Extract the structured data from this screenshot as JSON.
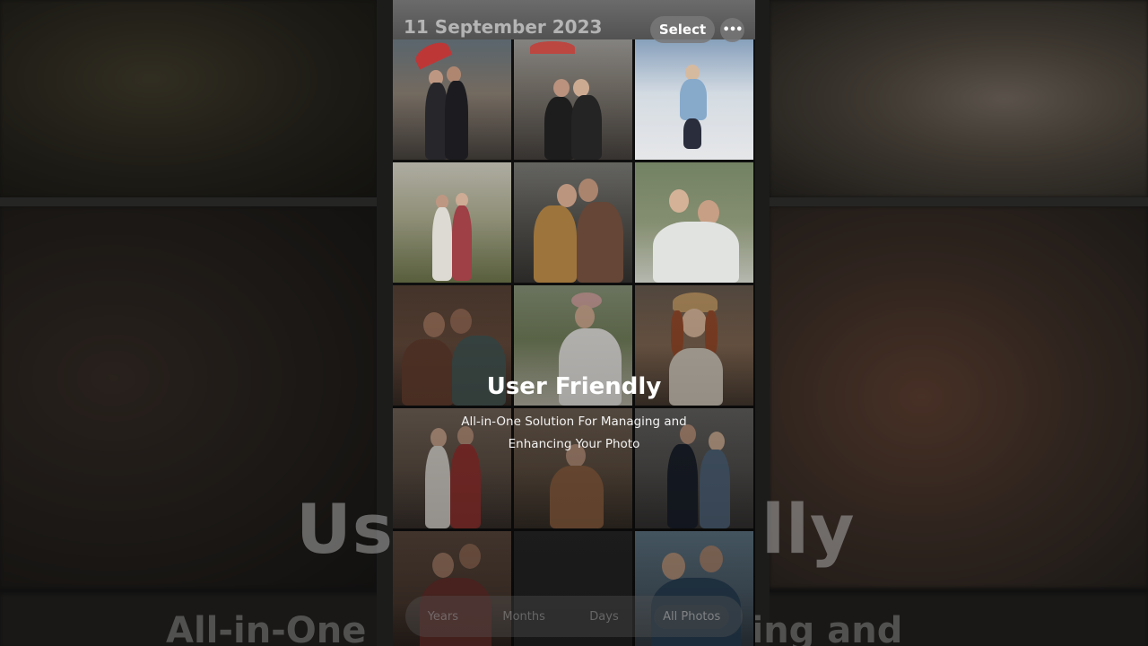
{
  "header": {
    "date_title": "11 September 2023",
    "select_label": "Select",
    "more_label": "•••"
  },
  "overlay": {
    "title": "User Friendly",
    "subtitle_line1": "All-in-One Solution For Managing and",
    "subtitle_line2": "Enhancing Your Photo"
  },
  "background_text": {
    "big_title_left": "Us",
    "big_title_right": "lly",
    "big_sub_left": "All-in-One",
    "big_sub_right": "naging and"
  },
  "tabs": [
    {
      "label": "Years"
    },
    {
      "label": "Months"
    },
    {
      "label": "Days"
    },
    {
      "label": "All Photos"
    }
  ],
  "photo_grid": {
    "columns": 3,
    "count": 15
  }
}
